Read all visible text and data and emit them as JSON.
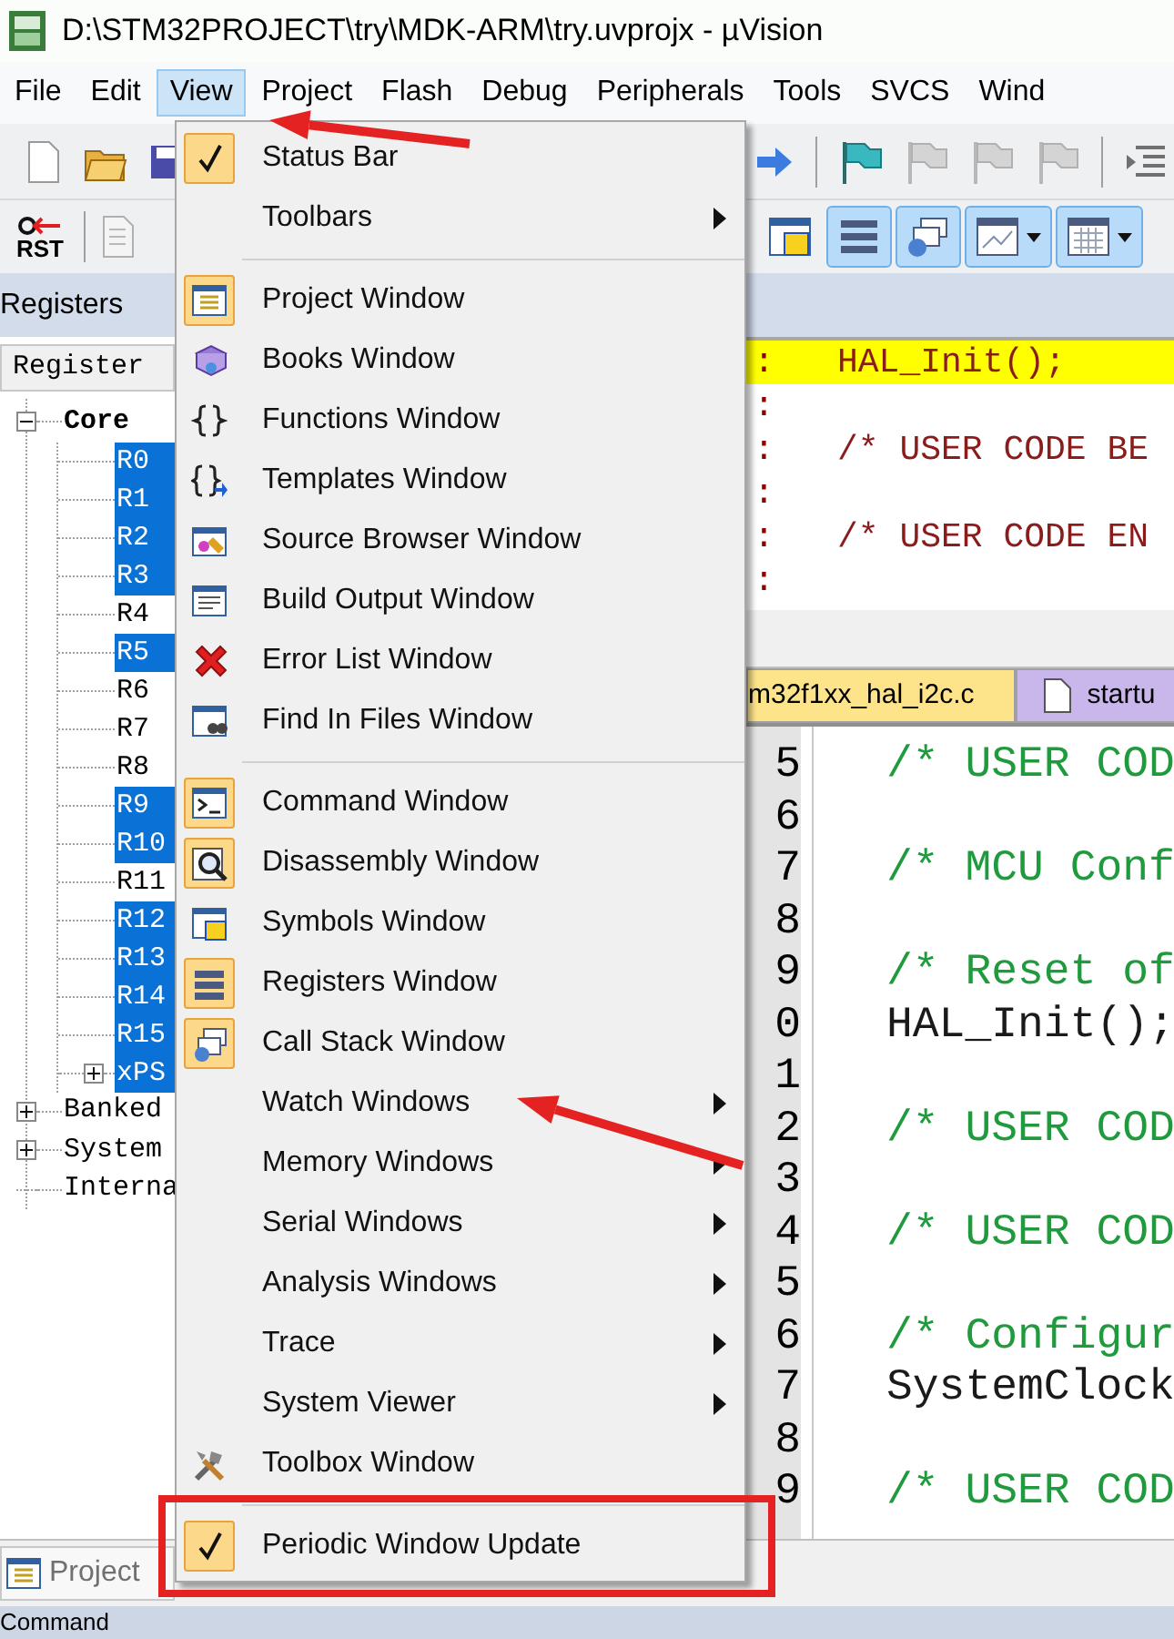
{
  "window": {
    "title": "D:\\STM32PROJECT\\try\\MDK-ARM\\try.uvprojx - µVision"
  },
  "menu_bar": [
    {
      "label": "File",
      "selected": false
    },
    {
      "label": "Edit",
      "selected": false
    },
    {
      "label": "View",
      "selected": true
    },
    {
      "label": "Project",
      "selected": false
    },
    {
      "label": "Flash",
      "selected": false
    },
    {
      "label": "Debug",
      "selected": false
    },
    {
      "label": "Peripherals",
      "selected": false
    },
    {
      "label": "Tools",
      "selected": false
    },
    {
      "label": "SVCS",
      "selected": false
    },
    {
      "label": "Wind",
      "selected": false
    }
  ],
  "toolbar_2": {
    "reset_label": "RST",
    "toggles": [
      {
        "pressed": false
      },
      {
        "pressed": true
      },
      {
        "pressed": true
      },
      {
        "pressed": true
      },
      {
        "pressed": true
      }
    ]
  },
  "registers_panel": {
    "title": "Registers",
    "column_header": "Register",
    "tree": [
      {
        "label": "Core",
        "expanded": true,
        "selected": false,
        "children": [
          {
            "label": "R0",
            "selected": true
          },
          {
            "label": "R1",
            "selected": true
          },
          {
            "label": "R2",
            "selected": true
          },
          {
            "label": "R3",
            "selected": true
          },
          {
            "label": "R4",
            "selected": false
          },
          {
            "label": "R5",
            "selected": true
          },
          {
            "label": "R6",
            "selected": false
          },
          {
            "label": "R7",
            "selected": false
          },
          {
            "label": "R8",
            "selected": false
          },
          {
            "label": "R9",
            "selected": true
          },
          {
            "label": "R10",
            "selected": true
          },
          {
            "label": "R11",
            "selected": false
          },
          {
            "label": "R12",
            "selected": true
          },
          {
            "label": "R13",
            "selected": true
          },
          {
            "label": "R14",
            "selected": true
          },
          {
            "label": "R15",
            "selected": true
          },
          {
            "label": "xPS",
            "selected": true,
            "expanded": false
          }
        ]
      },
      {
        "label": "Banked",
        "expanded": false,
        "selected": false
      },
      {
        "label": "System",
        "expanded": false,
        "selected": false
      },
      {
        "label": "Interna",
        "selected": false
      }
    ]
  },
  "view_menu": {
    "items": [
      {
        "kind": "item",
        "label": "Status Bar",
        "checked": true,
        "submenu": false
      },
      {
        "kind": "item",
        "label": "Toolbars",
        "checked": false,
        "submenu": true
      },
      {
        "kind": "separator"
      },
      {
        "kind": "item",
        "label": "Project Window",
        "checked": true,
        "submenu": false
      },
      {
        "kind": "item",
        "label": "Books Window",
        "checked": false,
        "submenu": false
      },
      {
        "kind": "item",
        "label": "Functions Window",
        "checked": false,
        "submenu": false
      },
      {
        "kind": "item",
        "label": "Templates Window",
        "checked": false,
        "submenu": false
      },
      {
        "kind": "item",
        "label": "Source Browser Window",
        "checked": false,
        "submenu": false
      },
      {
        "kind": "item",
        "label": "Build Output Window",
        "checked": false,
        "submenu": false
      },
      {
        "kind": "item",
        "label": "Error List Window",
        "checked": false,
        "submenu": false
      },
      {
        "kind": "item",
        "label": "Find In Files Window",
        "checked": false,
        "submenu": false
      },
      {
        "kind": "separator"
      },
      {
        "kind": "item",
        "label": "Command Window",
        "checked": true,
        "submenu": false
      },
      {
        "kind": "item",
        "label": "Disassembly Window",
        "checked": true,
        "submenu": false
      },
      {
        "kind": "item",
        "label": "Symbols Window",
        "checked": false,
        "submenu": false
      },
      {
        "kind": "item",
        "label": "Registers Window",
        "checked": true,
        "submenu": false
      },
      {
        "kind": "item",
        "label": "Call Stack Window",
        "checked": true,
        "submenu": false
      },
      {
        "kind": "item",
        "label": "Watch Windows",
        "checked": false,
        "submenu": true
      },
      {
        "kind": "item",
        "label": "Memory Windows",
        "checked": false,
        "submenu": true
      },
      {
        "kind": "item",
        "label": "Serial Windows",
        "checked": false,
        "submenu": true
      },
      {
        "kind": "item",
        "label": "Analysis Windows",
        "checked": false,
        "submenu": true
      },
      {
        "kind": "item",
        "label": "Trace",
        "checked": false,
        "submenu": true
      },
      {
        "kind": "item",
        "label": "System Viewer",
        "checked": false,
        "submenu": true
      },
      {
        "kind": "item",
        "label": "Toolbox Window",
        "checked": false,
        "submenu": false
      },
      {
        "kind": "separator"
      },
      {
        "kind": "item",
        "label": "Periodic Window Update",
        "checked": true,
        "submenu": false
      }
    ]
  },
  "disassembly": {
    "lines": [
      {
        "marker": ":",
        "code": "HAL_Init();",
        "current": true
      },
      {
        "marker": ":",
        "current": false
      },
      {
        "marker": ":",
        "code": "/* USER CODE BE",
        "current": false
      },
      {
        "marker": ":",
        "current": false
      },
      {
        "marker": ":",
        "code": "/* USER CODE EN",
        "current": false
      },
      {
        "marker": ":",
        "current": false
      }
    ]
  },
  "editor_tabs": [
    {
      "label": "m32f1xx_hal_i2c.c",
      "selected": true
    },
    {
      "label": "startu",
      "selected": false
    }
  ],
  "editor": {
    "lines": [
      {
        "number": "5",
        "kind": "comment",
        "text": "/* USER COD"
      },
      {
        "number": "6"
      },
      {
        "number": "7",
        "kind": "comment",
        "text": "/* MCU Conf"
      },
      {
        "number": "8"
      },
      {
        "number": "9",
        "kind": "comment",
        "text": "/* Reset of"
      },
      {
        "number": "0",
        "kind": "code",
        "text": "HAL_Init();"
      },
      {
        "number": "1"
      },
      {
        "number": "2",
        "kind": "comment",
        "text": "/* USER COD"
      },
      {
        "number": "3"
      },
      {
        "number": "4",
        "kind": "comment",
        "text": "/* USER COD"
      },
      {
        "number": "5"
      },
      {
        "number": "6",
        "kind": "comment",
        "text": "/* Configur"
      },
      {
        "number": "7",
        "kind": "code",
        "text": "SystemClock"
      },
      {
        "number": "8"
      },
      {
        "number": "9",
        "kind": "comment",
        "text": "/* USER COD"
      }
    ]
  },
  "project_tab": {
    "label": "Project"
  },
  "command_panel": {
    "title": "Command"
  },
  "annotations": [
    {
      "kind": "arrow"
    },
    {
      "kind": "arrow"
    },
    {
      "kind": "frame"
    }
  ]
}
